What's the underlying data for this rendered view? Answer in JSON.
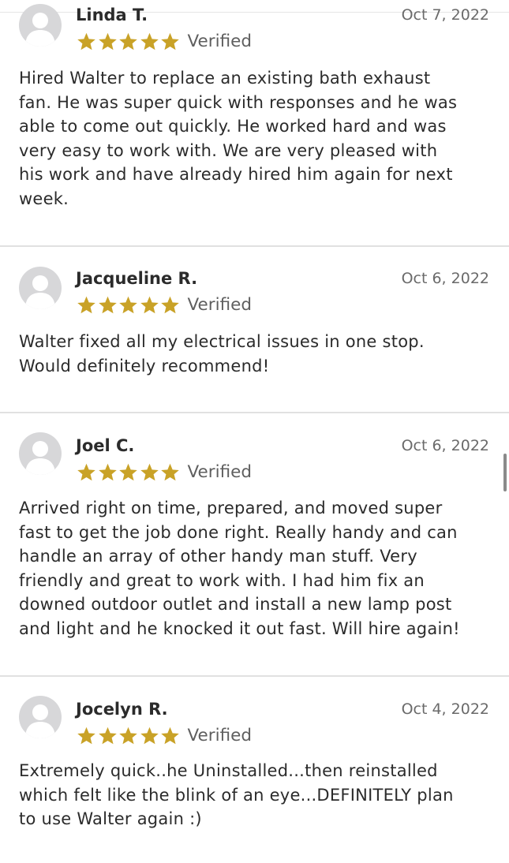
{
  "colors": {
    "star": "#c9a227",
    "avatar_bg": "#d7d7d9",
    "divider": "#e1e1e1"
  },
  "reviews": [
    {
      "name": "Linda T.",
      "date": "Oct 7, 2022",
      "rating": 5,
      "verified_label": "Verified",
      "lines": [
        "Hired Walter to replace an existing bath exhaust",
        "fan. He was super quick with responses and he was",
        "able to come out quickly. He worked hard and was",
        "very easy to work with. We are very pleased with",
        "his work and have already hired him again for next",
        "week."
      ]
    },
    {
      "name": "Jacqueline R.",
      "date": "Oct 6, 2022",
      "rating": 5,
      "verified_label": "Verified",
      "lines": [
        "Walter fixed all my electrical issues in one stop.",
        "Would definitely recommend!"
      ]
    },
    {
      "name": "Joel C.",
      "date": "Oct 6, 2022",
      "rating": 5,
      "verified_label": "Verified",
      "lines": [
        "Arrived right on time, prepared, and moved super",
        "fast to get the job done right. Really handy and can",
        "handle an array of other handy man stuff. Very",
        "friendly and great to work with. I had him fix an",
        "downed outdoor outlet and install a new lamp post",
        "and light and he knocked it out fast. Will hire again!"
      ]
    },
    {
      "name": "Jocelyn R.",
      "date": "Oct 4, 2022",
      "rating": 5,
      "verified_label": "Verified",
      "lines": [
        "Extremely quick..he Uninstalled...then reinstalled",
        "which felt like the blink of an eye...DEFINITELY plan",
        "to use Walter again :)"
      ]
    }
  ]
}
